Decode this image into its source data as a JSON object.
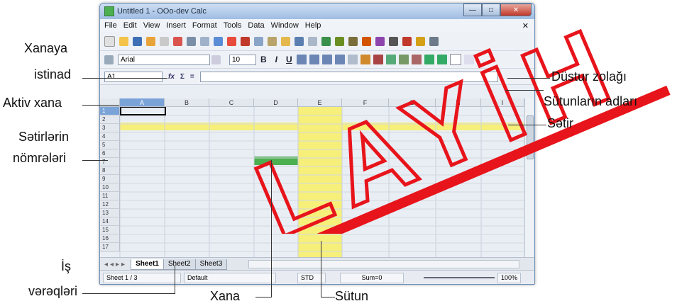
{
  "window": {
    "title": "Untitled 1 - OOo-dev Calc",
    "controls": {
      "minimize": "—",
      "maximize": "□",
      "close": "✕"
    }
  },
  "menubar": [
    "File",
    "Edit",
    "View",
    "Insert",
    "Format",
    "Tools",
    "Data",
    "Window",
    "Help"
  ],
  "menubar_close": "✕",
  "format_toolbar": {
    "font_name": "Arial",
    "font_size": "10",
    "bold": "B",
    "italic": "I",
    "underline": "U"
  },
  "formula_bar": {
    "name_box": "A1",
    "function_icon": "fx",
    "sum_icon": "Σ",
    "equals": "="
  },
  "columns": [
    "A",
    "B",
    "C",
    "D",
    "E",
    "F",
    "G",
    "H",
    "I"
  ],
  "rows": [
    "1",
    "2",
    "3",
    "4",
    "5",
    "6",
    "7",
    "8",
    "9",
    "10",
    "11",
    "12",
    "13",
    "14",
    "15",
    "16",
    "17"
  ],
  "sheet_tabs": [
    "Sheet1",
    "Sheet2",
    "Sheet3"
  ],
  "status_bar": {
    "sheet": "Sheet 1 / 3",
    "style": "Default",
    "mode": "STD",
    "sum": "Sum=0",
    "zoom": "100%"
  },
  "annotations": {
    "name_box": [
      "Xanaya",
      "istinad"
    ],
    "active_cell": "Aktiv xana",
    "row_numbers": [
      "Sətirlərin",
      "nömrələri"
    ],
    "sheets": [
      "İş",
      "vərəqləri"
    ],
    "cell": "Xana",
    "column": "Sütun",
    "formula_bar": "Düstur zolağı",
    "column_names": "Sütunların adları",
    "row": "Sətir"
  },
  "watermark": "LAYİH",
  "colors": {
    "highlight_yellow": "#f6ef7a",
    "cell_green": "#4caf50",
    "watermark_red": "#e8141b"
  }
}
